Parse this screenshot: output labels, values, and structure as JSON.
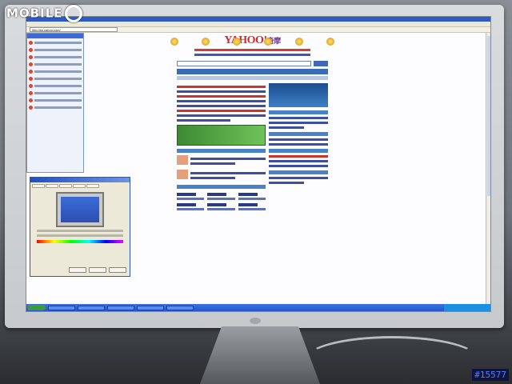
{
  "watermark": {
    "text": "MOBILE"
  },
  "post_id": "#15577",
  "browser": {
    "address": "http://tw.yahoo.com/"
  },
  "yahoo": {
    "logo": "YAHOO!",
    "logo_sub": "奇摩"
  },
  "colors": {
    "yahoo_red": "#e0232b",
    "link_blue": "#3c4fa0",
    "xp_blue": "#2456c9"
  }
}
